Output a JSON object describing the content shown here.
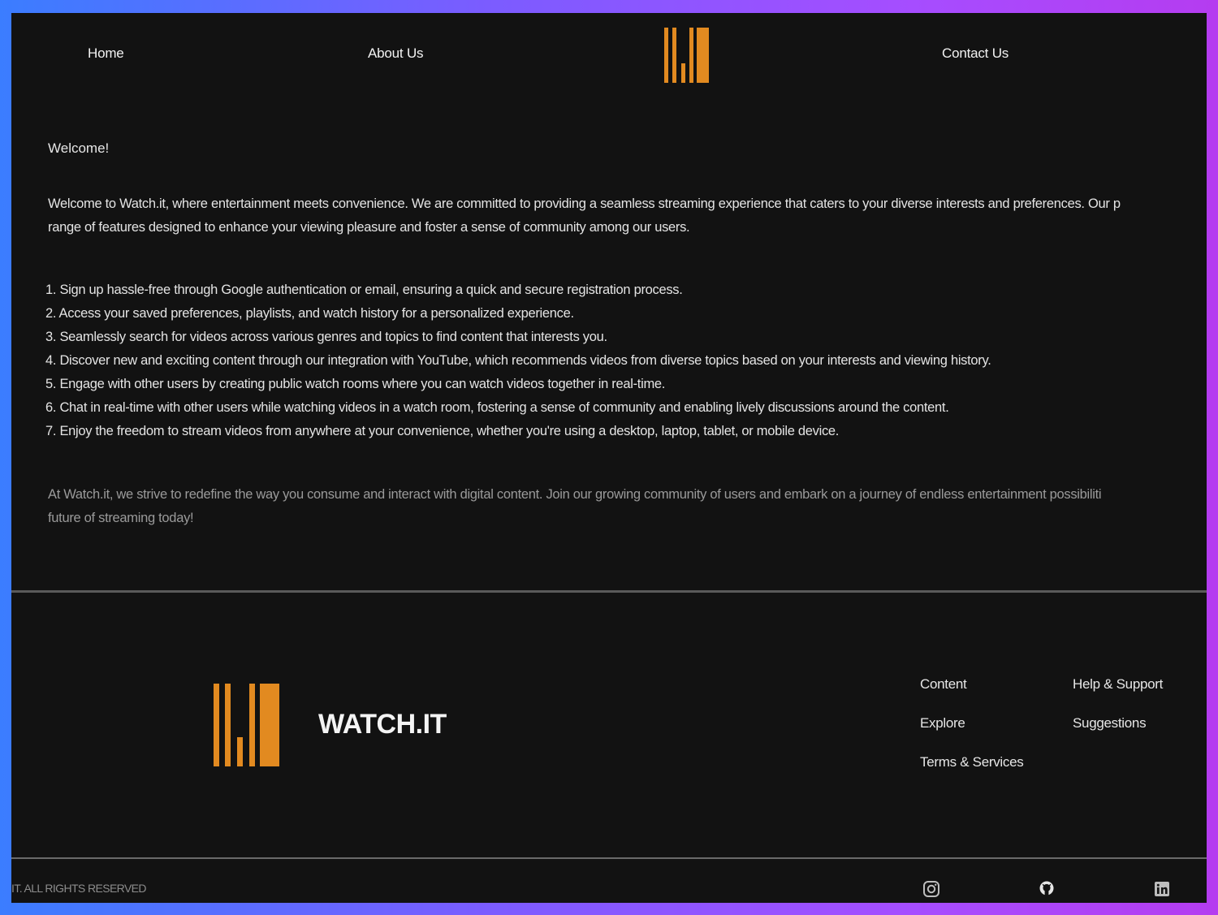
{
  "nav": {
    "home": "Home",
    "about": "About Us",
    "contact": "Contact Us"
  },
  "content": {
    "welcome": "Welcome!",
    "intro_line1": "Welcome to Watch.it, where entertainment meets convenience. We are committed to providing a seamless streaming experience that caters to your diverse interests and preferences. Our p",
    "intro_line2": "range of features designed to enhance your viewing pleasure and foster a sense of community among our users.",
    "features": [
      "1. Sign up hassle-free through Google authentication or email, ensuring a quick and secure registration process.",
      "2. Access your saved preferences, playlists, and watch history for a personalized experience.",
      "3. Seamlessly search for videos across various genres and topics to find content that interests you.",
      "4. Discover new and exciting content through our integration with YouTube, which recommends videos from diverse topics based on your interests and viewing history.",
      "5. Engage with other users by creating public watch rooms where you can watch videos together in real-time.",
      "6. Chat in real-time with other users while watching videos in a watch room, fostering a sense of community and enabling lively discussions around the content.",
      "7. Enjoy the freedom to stream videos from anywhere at your convenience, whether you're using a desktop, laptop, tablet, or mobile device."
    ],
    "closing_line1": "At Watch.it, we strive to redefine the way you consume and interact with digital content. Join our growing community of users and embark on a journey of endless entertainment possibiliti",
    "closing_line2": "future of streaming today!"
  },
  "footer": {
    "brand": "WATCH.IT",
    "links": {
      "content": "Content",
      "explore": "Explore",
      "terms": "Terms & Services",
      "help": "Help & Support",
      "suggestions": "Suggestions"
    },
    "copyright": "IT. ALL RIGHTS RESERVED",
    "social_icons": [
      "instagram-icon",
      "github-icon",
      "linkedin-icon"
    ]
  },
  "colors": {
    "accent": "#e28a20",
    "background": "#121212",
    "frame_gradient": [
      "#3b7dff",
      "#b53cf0"
    ]
  }
}
